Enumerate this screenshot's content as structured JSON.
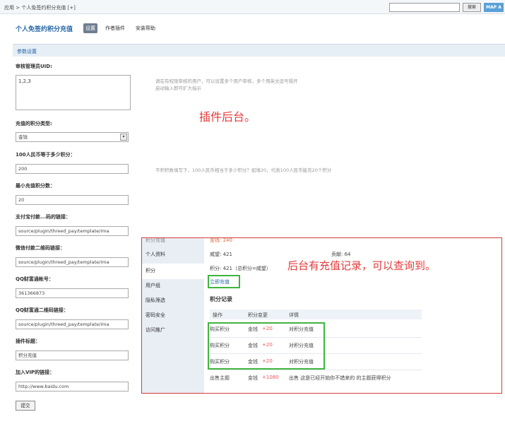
{
  "topbar": {
    "breadcrumb": "应用 > 个人免签约积分充值 [+]",
    "search_button": "搜索",
    "map_button": "MAP A"
  },
  "plugin": {
    "title": "个人免签约积分充值",
    "tabs": [
      "设置",
      "作者插件",
      "安装帮助"
    ]
  },
  "section": {
    "title": "参数设置"
  },
  "form": {
    "admin_uid_label": "审核管理员UID:",
    "admin_uid_value": "1,2,3",
    "admin_uid_hint": [
      "请在有权限审核的用户，可以设置多个用户审核，多个用英文逗号隔开",
      "启动输入即可扩大指示"
    ],
    "credit_type_label": "充值的积分类型:",
    "credit_type_value": "金钱",
    "ratio_label": "100人民币等于多少积分：",
    "ratio_value": "200",
    "ratio_hint": "不积积数填写下，100人民币相当于多少积分？如填20，代表100人民币能充20个积分",
    "min_label": "最小充值积分数：",
    "min_value": "20",
    "alipay_label": "支付宝付款...码的链接：",
    "alipay_value": "source/plugin/threed_pay/template/ima",
    "wechat_label": "微信付款二维码链接：",
    "wechat_value": "source/plugin/threed_pay/template/ima",
    "qq_label": "QQ财富通帐号：",
    "qq_value": "361366873",
    "qq_qr_label": "QQ财富通二维码链接：",
    "qq_qr_value": "source/plugin/threed_pay/template/ima",
    "plugin_title_label": "插件标题：",
    "plugin_title_value": "积分充值",
    "vip_label": "加入VIP的链接：",
    "vip_value": "http://www.baidu.com",
    "submit": "提交"
  },
  "notes": {
    "backend": "插件后台。",
    "records": "后台有充值记录，可以查询到。"
  },
  "overlay": {
    "sidebar": [
      "积分充值",
      "个人资料",
      "积分",
      "用户组",
      "隐私筛选",
      "密码安全",
      "访问推广"
    ],
    "top_cut": "金钱: 240",
    "prestige": "威望: 421",
    "contribution": "贡献: 64",
    "credits": "积分: 421（总积分=威望）",
    "recharge_link": "立即充值",
    "record_heading": "积分记录",
    "columns": [
      "操作",
      "积分变更",
      "详情"
    ],
    "rows": [
      {
        "op": "购买积分",
        "currency": "金钱",
        "amount": "+20",
        "detail": "对积分充值"
      },
      {
        "op": "购买积分",
        "currency": "金钱",
        "amount": "+20",
        "detail": "对积分充值"
      },
      {
        "op": "购买积分",
        "currency": "金钱",
        "amount": "+20",
        "detail": "对积分充值"
      },
      {
        "op": "出售主题",
        "currency": "金钱",
        "amount": "+1080",
        "detail": "出售 这是已经开始你不错来的 的主题获得积分"
      }
    ]
  },
  "colors": {
    "accent": "#2366a8",
    "note_red": "#e53b3b",
    "highlight_green": "#3fb43f",
    "overlay_border": "#d43c3c"
  }
}
